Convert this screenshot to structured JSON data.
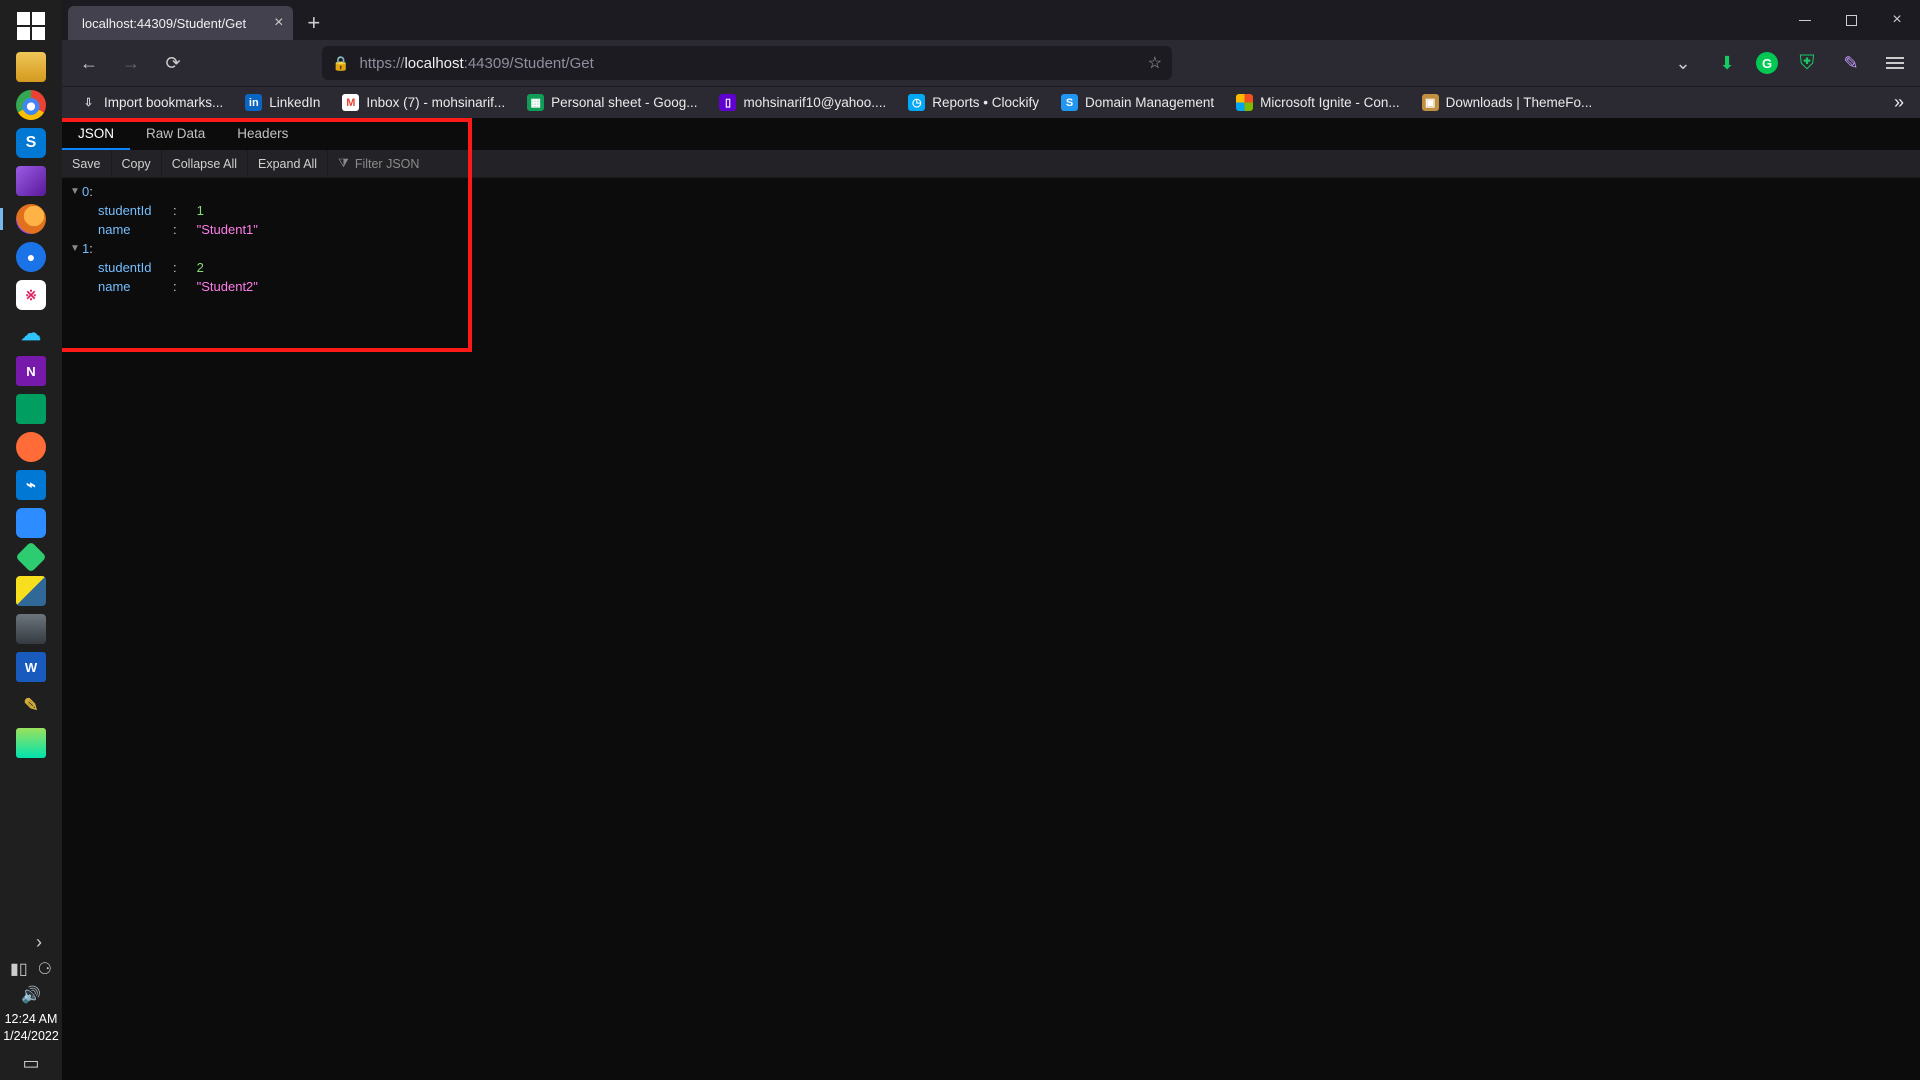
{
  "taskbar": {
    "icons": [
      {
        "name": "file-explorer",
        "letter": ""
      },
      {
        "name": "chrome",
        "letter": ""
      },
      {
        "name": "skype",
        "letter": "S"
      },
      {
        "name": "visual-studio",
        "letter": ""
      },
      {
        "name": "firefox",
        "letter": ""
      },
      {
        "name": "maps",
        "letter": "●"
      },
      {
        "name": "slack",
        "letter": "※"
      },
      {
        "name": "cloud",
        "letter": "☁"
      },
      {
        "name": "onenote",
        "letter": "N"
      },
      {
        "name": "green-square",
        "letter": ""
      },
      {
        "name": "postman",
        "letter": ""
      },
      {
        "name": "vscode",
        "letter": "⌁"
      },
      {
        "name": "zoom",
        "letter": ""
      },
      {
        "name": "green-diamond",
        "letter": ""
      },
      {
        "name": "pycharm",
        "letter": ""
      },
      {
        "name": "pictures",
        "letter": ""
      },
      {
        "name": "word",
        "letter": "W"
      },
      {
        "name": "brush",
        "letter": "✎"
      },
      {
        "name": "sheet",
        "letter": ""
      }
    ],
    "time": "12:24 AM",
    "date": "1/24/2022"
  },
  "browser": {
    "tab_title": "localhost:44309/Student/Get",
    "url": {
      "scheme": "https://",
      "host": "localhost",
      "rest": ":44309/Student/Get"
    },
    "bookmarks": [
      {
        "label": "Import bookmarks...",
        "color": "#8f8f8f",
        "ico": "⇩"
      },
      {
        "label": "LinkedIn",
        "color": "#0a66c2",
        "ico": "in"
      },
      {
        "label": "Inbox (7) - mohsinarif...",
        "color": "#ea4335",
        "ico": "M"
      },
      {
        "label": "Personal sheet - Goog...",
        "color": "#0f9d58",
        "ico": "▦"
      },
      {
        "label": "mohsinarif10@yahoo....",
        "color": "#6001d2",
        "ico": "▯"
      },
      {
        "label": "Reports • Clockify",
        "color": "#03a9f4",
        "ico": "◷"
      },
      {
        "label": "Domain Management",
        "color": "#2196f3",
        "ico": "S"
      },
      {
        "label": "Microsoft Ignite - Con...",
        "color": "",
        "ico": "ms"
      },
      {
        "label": "Downloads | ThemeFo...",
        "color": "#c09040",
        "ico": "▣"
      }
    ],
    "viewer": {
      "tabs": {
        "json": "JSON",
        "raw": "Raw Data",
        "headers": "Headers"
      },
      "toolbar": {
        "save": "Save",
        "copy": "Copy",
        "collapse": "Collapse All",
        "expand": "Expand All",
        "filter_placeholder": "Filter JSON"
      },
      "data": [
        {
          "index": "0",
          "studentId": "1",
          "name": "\"Student1\""
        },
        {
          "index": "1",
          "studentId": "2",
          "name": "\"Student2\""
        }
      ],
      "keys": {
        "studentId": "studentId",
        "name": "name"
      }
    }
  },
  "highlight": {
    "visible": true
  }
}
